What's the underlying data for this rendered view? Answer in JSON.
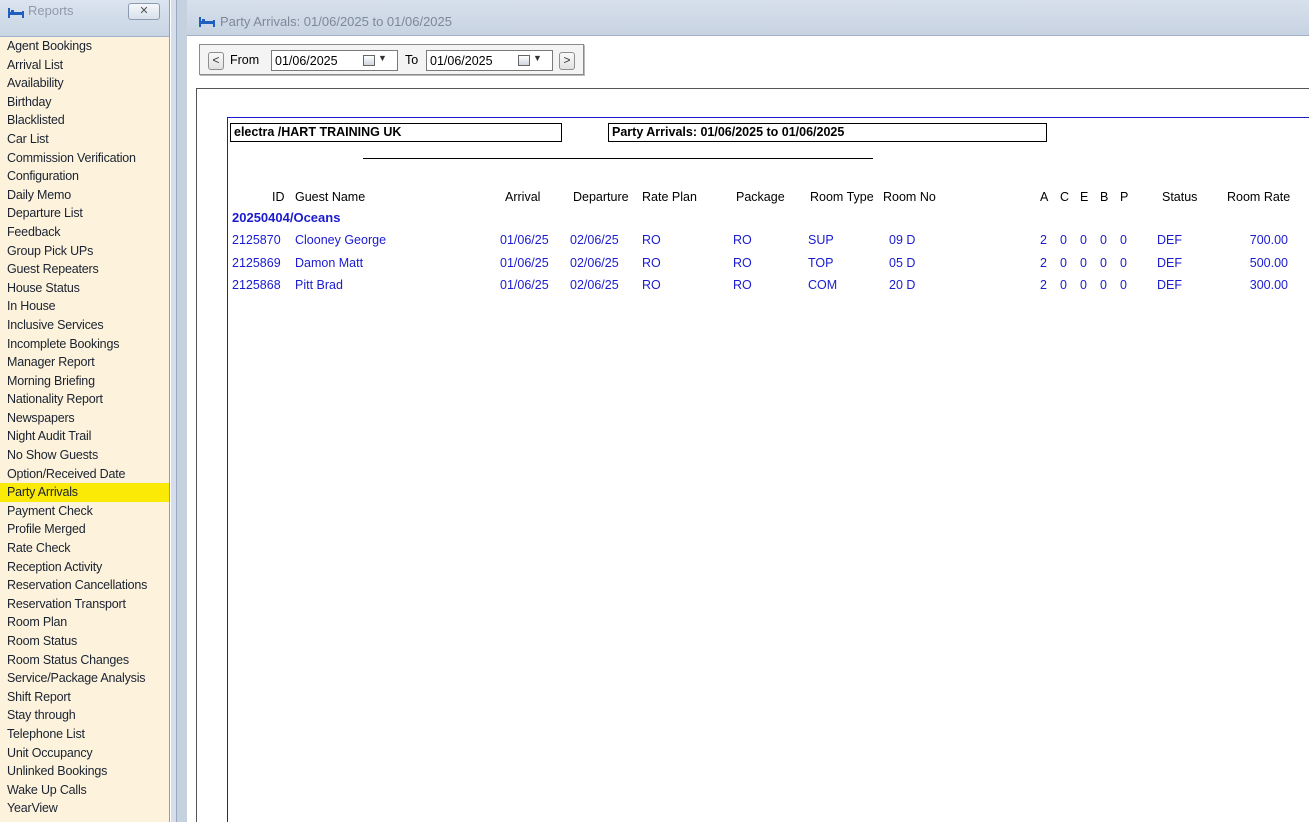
{
  "sidebar": {
    "title": "Reports",
    "close_label": "✕",
    "items": [
      "Agent Bookings",
      "Arrival List",
      "Availability",
      "Birthday",
      "Blacklisted",
      "Car List",
      "Commission Verification",
      "Configuration",
      "Daily Memo",
      "Departure List",
      "Feedback",
      "Group Pick UPs",
      "Guest Repeaters",
      "House Status",
      "In House",
      "Inclusive Services",
      "Incomplete Bookings",
      "Manager Report",
      "Morning Briefing",
      "Nationality Report",
      "Newspapers",
      "Night Audit Trail",
      "No Show Guests",
      "Option/Received Date",
      "Party Arrivals",
      "Payment Check",
      "Profile Merged",
      "Rate Check",
      "Reception Activity",
      "Reservation Cancellations",
      "Reservation Transport",
      "Room Plan",
      "Room Status",
      "Room Status Changes",
      "Service/Package Analysis",
      "Shift Report",
      "Stay through",
      "Telephone List",
      "Unit Occupancy",
      "Unlinked Bookings",
      "Wake Up Calls",
      "YearView"
    ],
    "selected": "Party Arrivals"
  },
  "main": {
    "title": "Party Arrivals: 01/06/2025 to 01/06/2025"
  },
  "toolbar": {
    "prev_label": "<",
    "next_label": ">",
    "from_label": "From",
    "to_label": "To",
    "from_value": "01/06/2025",
    "to_value": "01/06/2025"
  },
  "report": {
    "property": "electra /HART TRAINING UK",
    "heading": "Party Arrivals: 01/06/2025 to 01/06/2025",
    "columns": {
      "id": "ID",
      "guest": "Guest Name",
      "arrival": "Arrival",
      "departure": "Departure",
      "rate_plan": "Rate Plan",
      "package": "Package",
      "room_type": "Room Type",
      "room_no": "Room No",
      "a": "A",
      "c": "C",
      "e": "E",
      "b": "B",
      "p": "P",
      "status": "Status",
      "room_rate": "Room Rate"
    },
    "group": "20250404/Oceans",
    "rows": [
      {
        "id": "2125870",
        "guest": "Clooney George",
        "arrival": "01/06/25",
        "departure": "02/06/25",
        "rate_plan": "RO",
        "package": "RO",
        "room_type": "SUP",
        "room_no": "09 D",
        "a": "2",
        "c": "0",
        "e": "0",
        "b": "0",
        "p": "0",
        "status": "DEF",
        "room_rate": "700.00"
      },
      {
        "id": "2125869",
        "guest": "Damon Matt",
        "arrival": "01/06/25",
        "departure": "02/06/25",
        "rate_plan": "RO",
        "package": "RO",
        "room_type": "TOP",
        "room_no": "05 D",
        "a": "2",
        "c": "0",
        "e": "0",
        "b": "0",
        "p": "0",
        "status": "DEF",
        "room_rate": "500.00"
      },
      {
        "id": "2125868",
        "guest": "Pitt Brad",
        "arrival": "01/06/25",
        "departure": "02/06/25",
        "rate_plan": "RO",
        "package": "RO",
        "room_type": "COM",
        "room_no": "20 D",
        "a": "2",
        "c": "0",
        "e": "0",
        "b": "0",
        "p": "0",
        "status": "DEF",
        "room_rate": "300.00"
      }
    ]
  },
  "colors": {
    "selected_bg": "#fbe906",
    "report_blue": "#1a1ad0",
    "sidebar_bg": "#fdf3dd"
  }
}
